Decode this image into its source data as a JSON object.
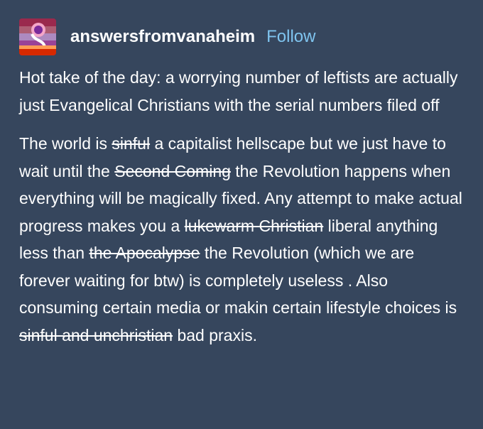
{
  "post": {
    "username": "answersfromvanaheim",
    "follow_label": "Follow",
    "avatar_icon": "pride-flag-avatar-icon",
    "colors": {
      "background": "#36465d",
      "text": "#ffffff",
      "follow": "#7fc4ef"
    },
    "paragraph1": "Hot take of the day: a worrying number of leftists are actually just Evangelical Christians  with the serial numbers filed off",
    "paragraph2": {
      "s1": "The world is ",
      "strike1": "sinful",
      "s2": " a capitalist hellscape but we just have to wait until the ",
      "strike2": "Second Coming",
      "s3": " the Revolution happens when everything will be magically fixed. Any attempt to make actual progress makes you a ",
      "strike3": "lukewarm Christian",
      "s4": " liberal anything less than ",
      "strike4": "the Apocalypse",
      "s5": " the Revolution (which we are forever waiting for btw) is completely useless . Also consuming certain media or makin certain lifestyle choices is ",
      "strike5": "sinful and unchristian",
      "s6": " bad praxis."
    }
  }
}
